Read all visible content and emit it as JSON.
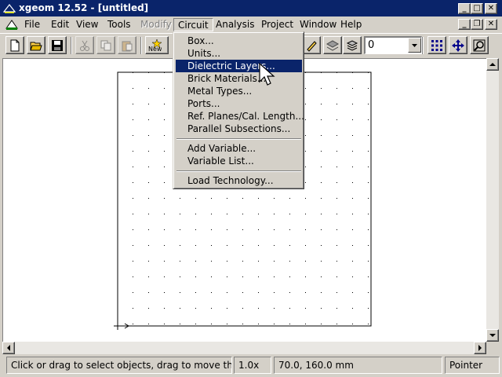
{
  "window": {
    "title": "xgeom 12.52 - [untitled]"
  },
  "menubar": {
    "file": "File",
    "edit": "Edit",
    "view": "View",
    "tools": "Tools",
    "modify": "Modify",
    "circuit": "Circuit",
    "analysis": "Analysis",
    "project": "Project",
    "window": "Window",
    "help": "Help"
  },
  "circuit_menu": {
    "items": [
      {
        "label": "Box..."
      },
      {
        "label": "Units..."
      },
      {
        "label": "Dielectric Layers..."
      },
      {
        "label": "Brick Materials..."
      },
      {
        "label": "Metal Types..."
      },
      {
        "label": "Ports..."
      },
      {
        "label": "Ref. Planes/Cal. Length..."
      },
      {
        "label": "Parallel Subsections..."
      },
      {
        "label": "Add Variable..."
      },
      {
        "label": "Variable List..."
      },
      {
        "label": "Load Technology..."
      }
    ]
  },
  "toolbar": {
    "new_label": "New",
    "level_value": "0"
  },
  "statusbar": {
    "hint": "Click or drag to select objects, drag to move them",
    "zoom": "1.0x",
    "coords": "70.0, 160.0 mm",
    "mode": "Pointer"
  },
  "colors": {
    "titlebar": "#0a246a",
    "menu_highlight": "#0a246a",
    "chrome": "#d4d0c8"
  }
}
